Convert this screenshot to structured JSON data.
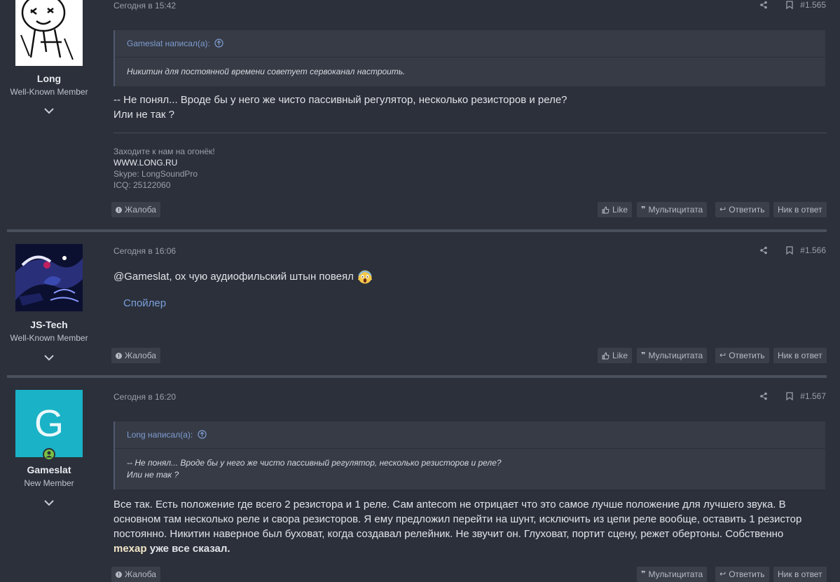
{
  "posts": [
    {
      "author": "Long",
      "role": "Well-Known Member",
      "date": "Сегодня в 15:42",
      "number": "#1.565",
      "quote": {
        "header": "Gameslat написал(а):",
        "lines": [
          "Никитин для постоянной времени советует сервоканал настроить."
        ]
      },
      "body": [
        "-- Не понял... Вроде бы у него же чисто пассивный регулятор, несколько резисторов и реле?",
        "Или не так ?"
      ],
      "signature": {
        "line1": "Заходите к нам на огонёк!",
        "line2": "WWW.LONG.RU",
        "line3": "Skype: LongSoundPro",
        "line4": "ICQ: 25122060"
      }
    },
    {
      "author": "JS-Tech",
      "role": "Well-Known Member",
      "date": "Сегодня в 16:06",
      "number": "#1.566",
      "mention": "@Gameslat",
      "body_text": ", ох чую аудиофильский штын повеял",
      "spoiler": "Спойлер"
    },
    {
      "author": "Gameslat",
      "role": "New Member",
      "avatar_letter": "G",
      "date": "Сегодня в 16:20",
      "number": "#1.567",
      "quote": {
        "header": "Long написал(а):",
        "lines": [
          "-- Не понял... Вроде бы у него же чисто пассивный регулятор, несколько резисторов и реле?",
          "Или не так ?"
        ]
      },
      "body": [
        "Все так. Есть положение где всего 2 резистора и 1 реле. Сам antecom не отрицает что это самое лучше положение для лучшего звука. В",
        "основном там несколько реле и свора резисторов. Я ему предложил перейти на шунт, исключить из цепи реле вообще, оставить 1 резистор",
        "постоянно. Никитин наверное был буховат, когда создавал релейник. Не звучит он. Глуховат, портит сцену, режет обертоны. Собственно"
      ],
      "body_bold_a": "mexap",
      "body_bold_b": " уже все сказал."
    }
  ],
  "actions": {
    "report": "Жалоба",
    "like": "Like",
    "multiquote": "Мультицитата",
    "reply": "Ответить",
    "nick": "Ник в ответ"
  },
  "colors": {
    "background": "#2b303b",
    "link": "#7aa0dc",
    "avatar_teal": "#1ab2c6"
  }
}
